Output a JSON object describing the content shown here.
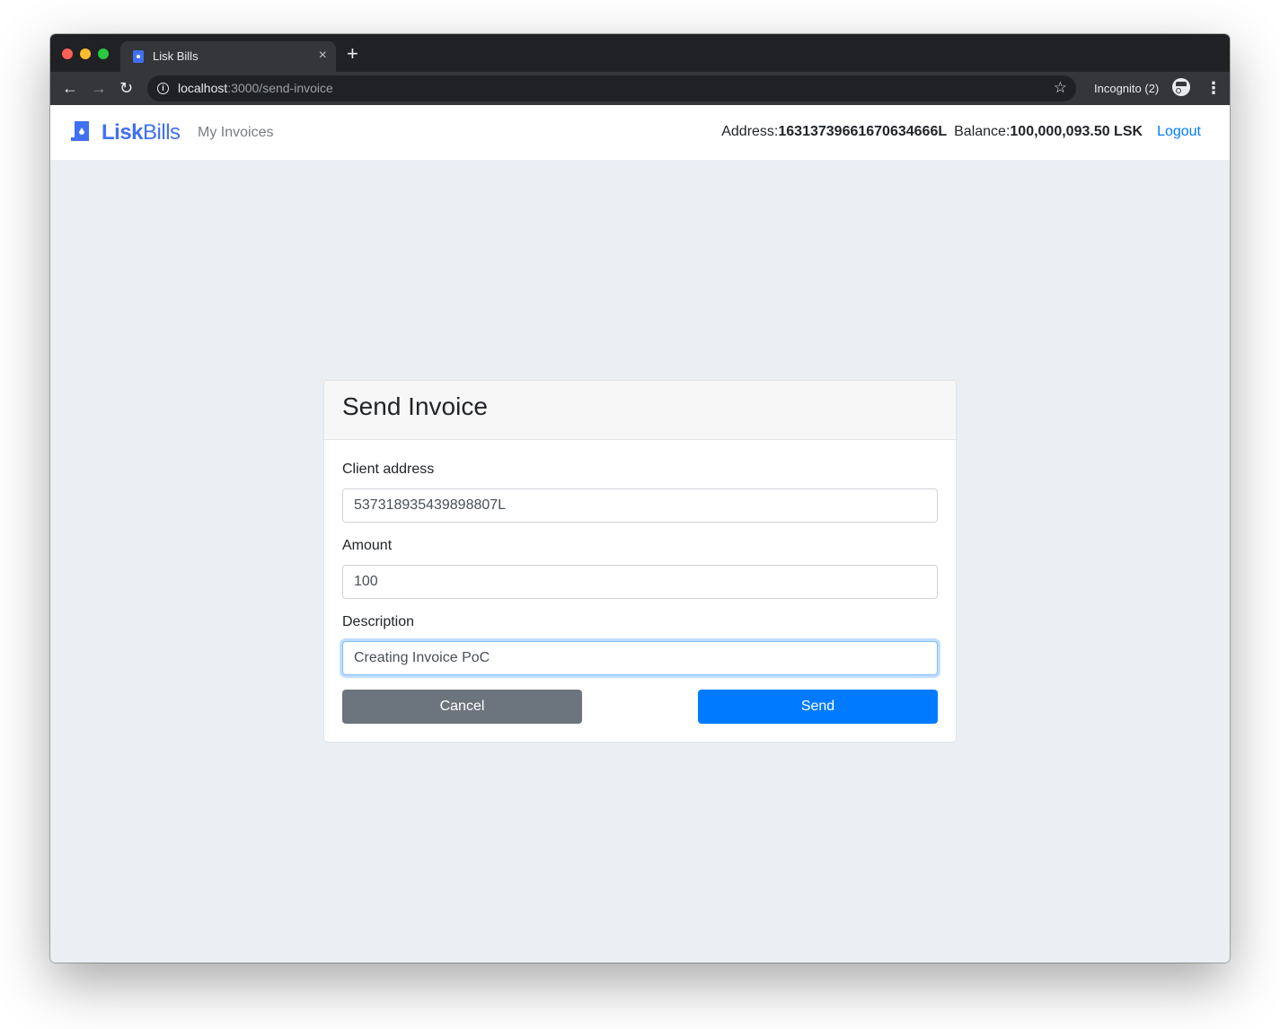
{
  "browser": {
    "tab_title": "Lisk Bills",
    "close_glyph": "×",
    "new_tab_glyph": "+",
    "url_host": "localhost",
    "url_path": ":3000/send-invoice",
    "incognito_label": "Incognito (2)"
  },
  "navbar": {
    "brand_bold": "Lisk",
    "brand_light": "Bills",
    "nav_link": "My Invoices",
    "address_label": "Address:",
    "address_value": "16313739661670634666L",
    "balance_label": "Balance:",
    "balance_value": "100,000,093.50 LSK",
    "logout_label": "Logout",
    "brand_color": "#4070f4",
    "link_color": "#007bff"
  },
  "form": {
    "title": "Send Invoice",
    "client_address_label": "Client address",
    "client_address_value": "537318935439898807L",
    "amount_label": "Amount",
    "amount_value": "100",
    "description_label": "Description",
    "description_value": "Creating Invoice PoC",
    "cancel_label": "Cancel",
    "send_label": "Send",
    "cancel_color": "#6c757d",
    "send_color": "#007bff"
  },
  "icons": [
    "back-arrow-icon",
    "forward-arrow-icon",
    "reload-icon",
    "info-icon",
    "star-icon",
    "incognito-icon",
    "more-vert-icon",
    "lisk-logo-icon"
  ]
}
